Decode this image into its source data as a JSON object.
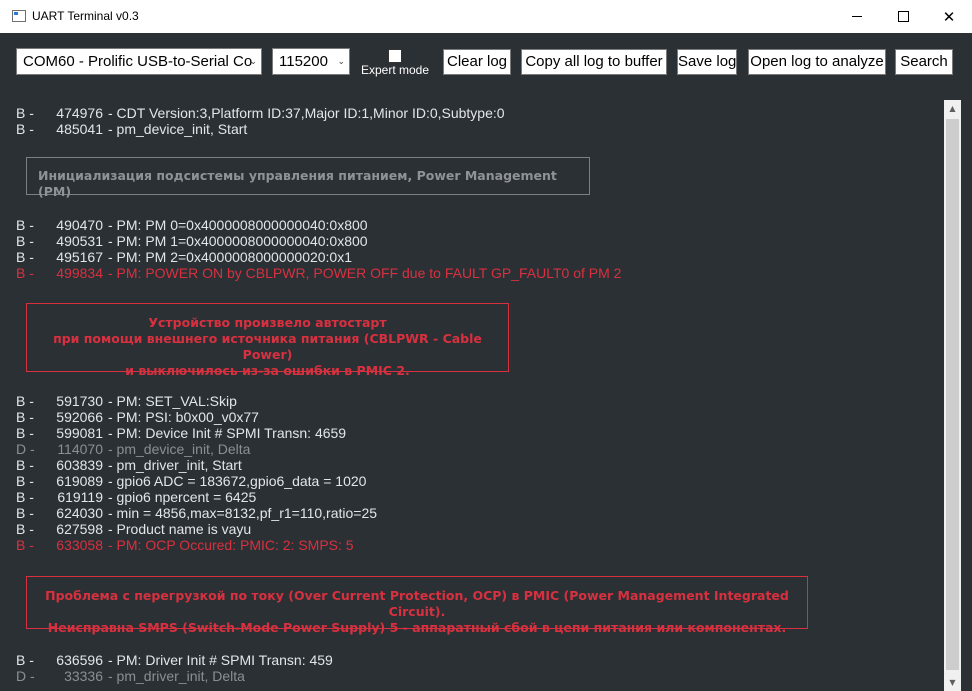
{
  "window": {
    "title": "UART Terminal v0.3",
    "minimize_icon": "minimize-icon",
    "maximize_icon": "maximize-icon",
    "close_glyph": "✕"
  },
  "toolbar": {
    "port_value": "COM60 - Prolific USB-to-Serial Co",
    "baud_value": "115200",
    "dropdown_glyph": "⌄",
    "expert_mode_label": "Expert mode",
    "clear_log": "Clear log",
    "copy_log": "Copy all log to buffer",
    "save_log": "Save log",
    "open_log": "Open log to analyze",
    "search": "Search"
  },
  "log": {
    "lines": [
      {
        "tag": "B -",
        "ts": "474976",
        "text": "- CDT Version:3,Platform ID:37,Major ID:1,Minor ID:0,Subtype:0",
        "level": "b"
      },
      {
        "tag": "B -",
        "ts": "485041",
        "text": "- pm_device_init, Start",
        "level": "b"
      },
      {
        "tag": "B -",
        "ts": "490470",
        "text": "- PM: PM 0=0x4000008000000040:0x800",
        "level": "b"
      },
      {
        "tag": "B -",
        "ts": "490531",
        "text": "- PM: PM 1=0x4000008000000040:0x800",
        "level": "b"
      },
      {
        "tag": "B -",
        "ts": "495167",
        "text": "- PM: PM 2=0x4000008000000020:0x1",
        "level": "b"
      },
      {
        "tag": "B -",
        "ts": "499834",
        "text": "- PM: POWER ON by CBLPWR, POWER OFF due to FAULT GP_FAULT0 of PM 2",
        "level": "err"
      },
      {
        "tag": "B -",
        "ts": "591730",
        "text": "- PM: SET_VAL:Skip",
        "level": "b"
      },
      {
        "tag": "B -",
        "ts": "592066",
        "text": "- PM: PSI: b0x00_v0x77",
        "level": "b"
      },
      {
        "tag": "B -",
        "ts": "599081",
        "text": "- PM: Device Init # SPMI Transn: 4659",
        "level": "b"
      },
      {
        "tag": "D -",
        "ts": "114070",
        "text": "- pm_device_init, Delta",
        "level": "d"
      },
      {
        "tag": "B -",
        "ts": "603839",
        "text": "- pm_driver_init, Start",
        "level": "b"
      },
      {
        "tag": "B -",
        "ts": "619089",
        "text": "- gpio6 ADC = 183672,gpio6_data = 1020",
        "level": "b"
      },
      {
        "tag": "B -",
        "ts": "619119",
        "text": "- gpio6 npercent = 6425",
        "level": "b"
      },
      {
        "tag": "B -",
        "ts": "624030",
        "text": "- min = 4856,max=8132,pf_r1=110,ratio=25",
        "level": "b"
      },
      {
        "tag": "B -",
        "ts": "627598",
        "text": "- Product name is vayu",
        "level": "b"
      },
      {
        "tag": "B -",
        "ts": "633058",
        "text": "- PM: OCP Occured: PMIC: 2: SMPS: 5",
        "level": "err"
      },
      {
        "tag": "B -",
        "ts": "636596",
        "text": "- PM: Driver Init # SPMI Transn: 459",
        "level": "b"
      },
      {
        "tag": "D -",
        "ts": "33336",
        "text": "- pm_driver_init, Delta",
        "level": "d"
      }
    ],
    "note_pm_init": "Инициализация подсистемы управления питанием, Power Management (PM)",
    "note_autostart": [
      "Устройство произвело автостарт",
      "при помощи внешнего источника питания (CBLPWR - Cable Power)",
      "и выключилось из-за ошибки в PMIC 2."
    ],
    "note_ocp": [
      "Проблема с перегрузкой по току (Over Current Protection, OCP) в PMIC (Power Management Integrated Circuit).",
      "Неисправна SMPS (Switch-Mode Power Supply) 5 - аппаратный сбой в цепи питания или компонентах."
    ]
  },
  "scrollbar": {
    "up_glyph": "▲",
    "down_glyph": "▼"
  },
  "colors": {
    "background": "#2b3035",
    "text": "#e2e6ea",
    "error": "#d9303f",
    "debug": "#8a8f94"
  }
}
